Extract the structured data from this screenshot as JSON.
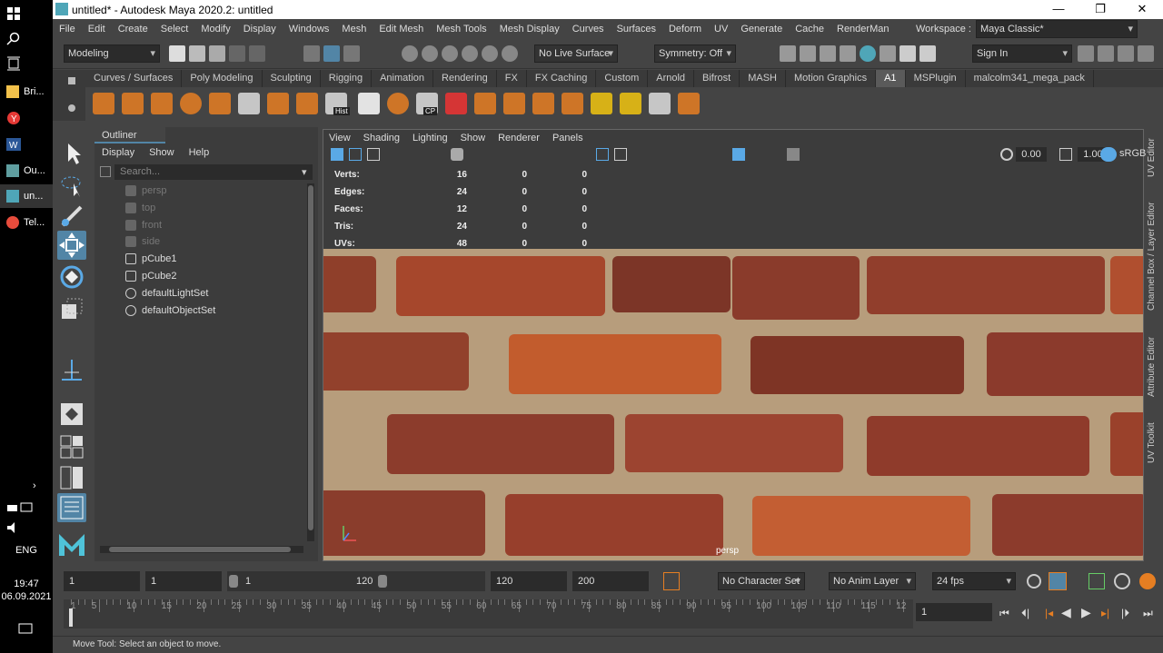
{
  "window": {
    "title": "untitled* - Autodesk Maya 2020.2: untitled",
    "minimize": "—",
    "maximize": "❐",
    "close": "✕"
  },
  "taskbar": {
    "items": [
      "Bri...",
      "Ou...",
      "un...",
      "Tel..."
    ],
    "lang": "ENG",
    "time": "19:47",
    "date": "06.09.2021"
  },
  "menubar": [
    "File",
    "Edit",
    "Create",
    "Select",
    "Modify",
    "Display",
    "Windows",
    "Mesh",
    "Edit Mesh",
    "Mesh Tools",
    "Mesh Display",
    "Curves",
    "Surfaces",
    "Deform",
    "UV",
    "Generate",
    "Cache",
    "RenderMan"
  ],
  "workspace": {
    "label": "Workspace :",
    "value": "Maya Classic*"
  },
  "status": {
    "menuset": "Modeling",
    "live": "No Live Surface",
    "symmetry": "Symmetry: Off",
    "signin": "Sign In"
  },
  "shelf_tabs": [
    "Curves / Surfaces",
    "Poly Modeling",
    "Sculpting",
    "Rigging",
    "Animation",
    "Rendering",
    "FX",
    "FX Caching",
    "Custom",
    "Arnold",
    "Bifrost",
    "MASH",
    "Motion Graphics",
    "A1",
    "MSPlugin",
    "malcolm341_mega_pack"
  ],
  "shelf_active": "A1",
  "shelf_labels": {
    "hist": "Hist",
    "cp": "CP"
  },
  "outliner": {
    "title": "Outliner",
    "menus": [
      "Display",
      "Show",
      "Help"
    ],
    "search": "Search...",
    "items": [
      {
        "name": "persp",
        "dim": true
      },
      {
        "name": "top",
        "dim": true
      },
      {
        "name": "front",
        "dim": true
      },
      {
        "name": "side",
        "dim": true
      },
      {
        "name": "pCube1",
        "dim": false
      },
      {
        "name": "pCube2",
        "dim": false
      },
      {
        "name": "defaultLightSet",
        "dim": false
      },
      {
        "name": "defaultObjectSet",
        "dim": false
      }
    ]
  },
  "viewport": {
    "menus": [
      "View",
      "Shading",
      "Lighting",
      "Show",
      "Renderer",
      "Panels"
    ],
    "exposure": "0.00",
    "gamma": "1.00",
    "colorspace": "sRGB",
    "camera": "persp",
    "hud": [
      {
        "label": "Verts:",
        "v": [
          "16",
          "0",
          "0"
        ]
      },
      {
        "label": "Edges:",
        "v": [
          "24",
          "0",
          "0"
        ]
      },
      {
        "label": "Faces:",
        "v": [
          "12",
          "0",
          "0"
        ]
      },
      {
        "label": "Tris:",
        "v": [
          "24",
          "0",
          "0"
        ]
      },
      {
        "label": "UVs:",
        "v": [
          "48",
          "0",
          "0"
        ]
      }
    ]
  },
  "side_tabs": [
    "UV Editor",
    "Channel Box / Layer Editor",
    "Attribute Editor",
    "UV Toolkit"
  ],
  "range": {
    "start": "1",
    "start2": "1",
    "slider_start": "1",
    "slider_end": "120",
    "end": "120",
    "end2": "200",
    "character": "No Character Set",
    "anim_layer": "No Anim Layer",
    "fps": "24 fps",
    "current": "1"
  },
  "timeline_ticks": [
    "1",
    "5",
    "10",
    "15",
    "20",
    "25",
    "30",
    "35",
    "40",
    "45",
    "50",
    "55",
    "60",
    "65",
    "70",
    "75",
    "80",
    "85",
    "90",
    "95",
    "100",
    "105",
    "110",
    "115",
    "12"
  ],
  "help": "Move Tool: Select an object to move."
}
